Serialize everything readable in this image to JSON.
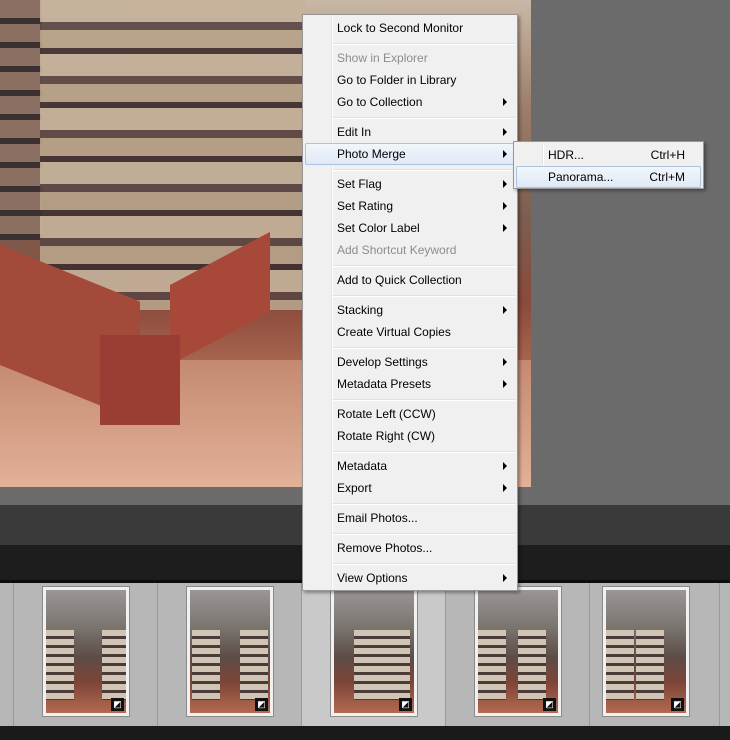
{
  "context_menu": {
    "items": [
      {
        "label": "Lock to Second Monitor",
        "submenu": false,
        "disabled": false
      },
      {
        "label": "Show in Explorer",
        "submenu": false,
        "disabled": true
      },
      {
        "label": "Go to Folder in Library",
        "submenu": false,
        "disabled": false
      },
      {
        "label": "Go to Collection",
        "submenu": true,
        "disabled": false
      },
      {
        "label": "Edit In",
        "submenu": true,
        "disabled": false
      },
      {
        "label": "Photo Merge",
        "submenu": true,
        "disabled": false,
        "highlighted": true
      },
      {
        "label": "Set Flag",
        "submenu": true,
        "disabled": false
      },
      {
        "label": "Set Rating",
        "submenu": true,
        "disabled": false
      },
      {
        "label": "Set Color Label",
        "submenu": true,
        "disabled": false
      },
      {
        "label": "Add Shortcut Keyword",
        "submenu": false,
        "disabled": true
      },
      {
        "label": "Add to Quick Collection",
        "submenu": false,
        "disabled": false
      },
      {
        "label": "Stacking",
        "submenu": true,
        "disabled": false
      },
      {
        "label": "Create Virtual Copies",
        "submenu": false,
        "disabled": false
      },
      {
        "label": "Develop Settings",
        "submenu": true,
        "disabled": false
      },
      {
        "label": "Metadata Presets",
        "submenu": true,
        "disabled": false
      },
      {
        "label": "Rotate Left (CCW)",
        "submenu": false,
        "disabled": false
      },
      {
        "label": "Rotate Right (CW)",
        "submenu": false,
        "disabled": false
      },
      {
        "label": "Metadata",
        "submenu": true,
        "disabled": false
      },
      {
        "label": "Export",
        "submenu": true,
        "disabled": false
      },
      {
        "label": "Email Photos...",
        "submenu": false,
        "disabled": false
      },
      {
        "label": "Remove Photos...",
        "submenu": false,
        "disabled": false
      },
      {
        "label": "View Options",
        "submenu": true,
        "disabled": false
      }
    ]
  },
  "photo_merge_submenu": {
    "items": [
      {
        "label": "HDR...",
        "shortcut": "Ctrl+H"
      },
      {
        "label": "Panorama...",
        "shortcut": "Ctrl+M",
        "highlighted": true
      }
    ]
  },
  "filmstrip": {
    "thumbnails": [
      {
        "badge": "◩"
      },
      {
        "badge": "◩"
      },
      {
        "badge": "◩",
        "selected": true
      },
      {
        "badge": "◩"
      },
      {
        "badge": "◩"
      }
    ]
  },
  "colors": {
    "menu_bg": "#f0f0f0",
    "highlight_border": "#a9c3e1",
    "disabled_text": "#8d8d8d"
  }
}
